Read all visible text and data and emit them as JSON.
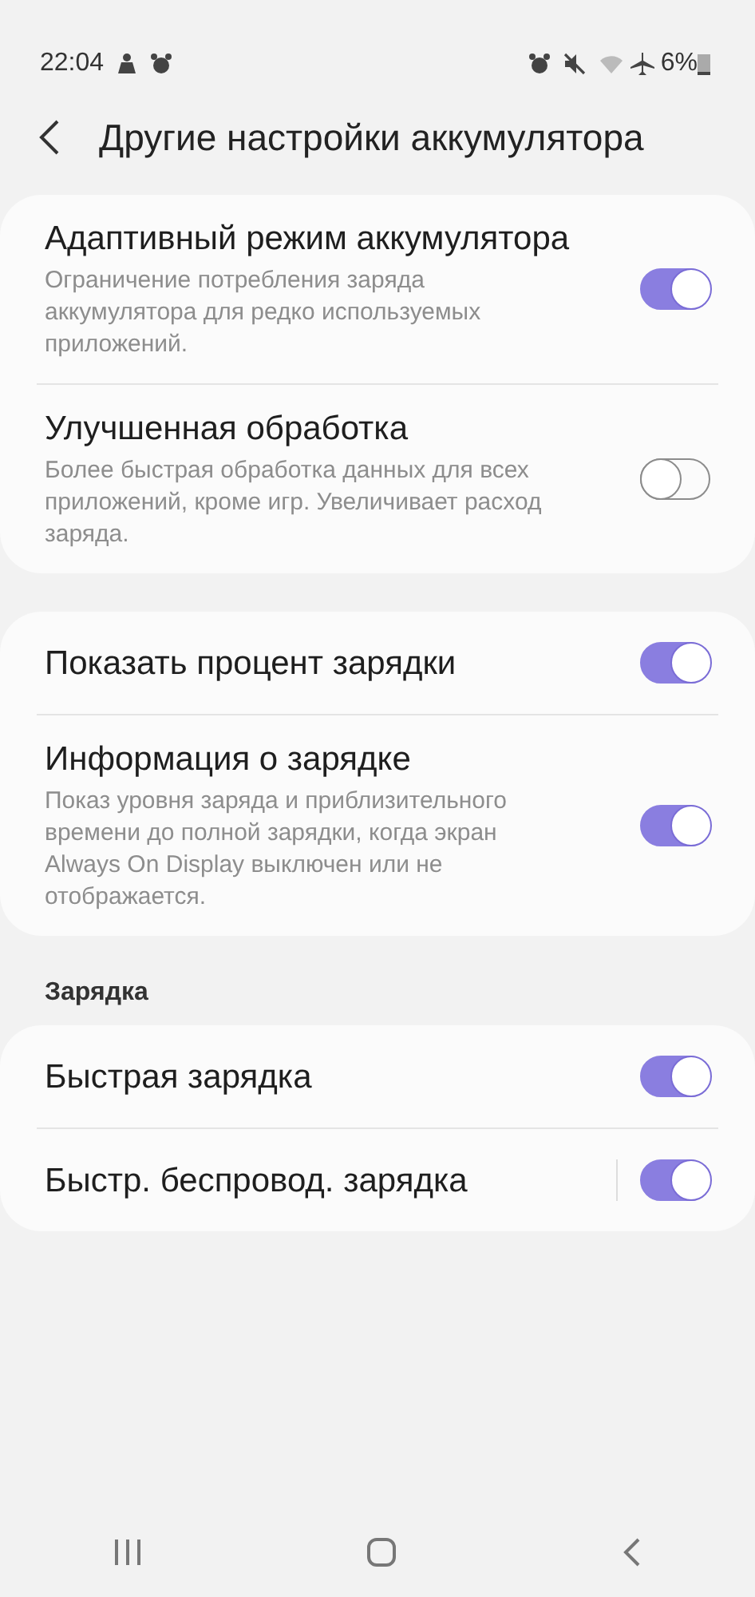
{
  "status_bar": {
    "time": "22:04",
    "battery": "6%"
  },
  "header": {
    "title": "Другие настройки аккумулятора"
  },
  "groups": [
    {
      "items": [
        {
          "title": "Адаптивный режим аккумулятора",
          "subtitle": "Ограничение потребления заряда аккумулятора для редко используемых приложений.",
          "on": true,
          "split": false
        },
        {
          "title": "Улучшенная обработка",
          "subtitle": "Более быстрая обработка данных для всех приложений, кроме игр. Увеличивает расход заряда.",
          "on": false,
          "split": false
        }
      ]
    },
    {
      "items": [
        {
          "title": "Показать процент зарядки",
          "on": true,
          "split": false
        },
        {
          "title": "Информация о зарядке",
          "subtitle": "Показ уровня заряда и приблизительного времени до полной зарядки, когда экран Always On Display выключен или не отображается.",
          "on": true,
          "split": false
        }
      ]
    },
    {
      "heading": "Зарядка",
      "items": [
        {
          "title": "Быстрая зарядка",
          "on": true,
          "split": false
        },
        {
          "title": "Быстр. беспровод. зарядка",
          "on": true,
          "split": true
        }
      ]
    }
  ]
}
